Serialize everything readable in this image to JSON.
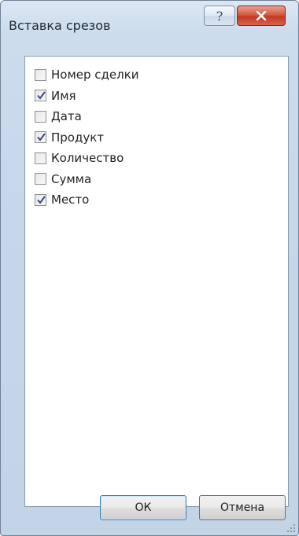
{
  "window": {
    "title": "Вставка срезов",
    "help_label": "?"
  },
  "fields": [
    {
      "label": "Номер сделки",
      "checked": false
    },
    {
      "label": "Имя",
      "checked": true
    },
    {
      "label": "Дата",
      "checked": false
    },
    {
      "label": "Продукт",
      "checked": true
    },
    {
      "label": "Количество",
      "checked": false
    },
    {
      "label": "Сумма",
      "checked": false
    },
    {
      "label": "Место",
      "checked": true
    }
  ],
  "buttons": {
    "ok_label": "ОК",
    "cancel_label": "Отмена"
  },
  "colors": {
    "close_button": "#c94a33",
    "ok_border": "#3c7fb1"
  }
}
